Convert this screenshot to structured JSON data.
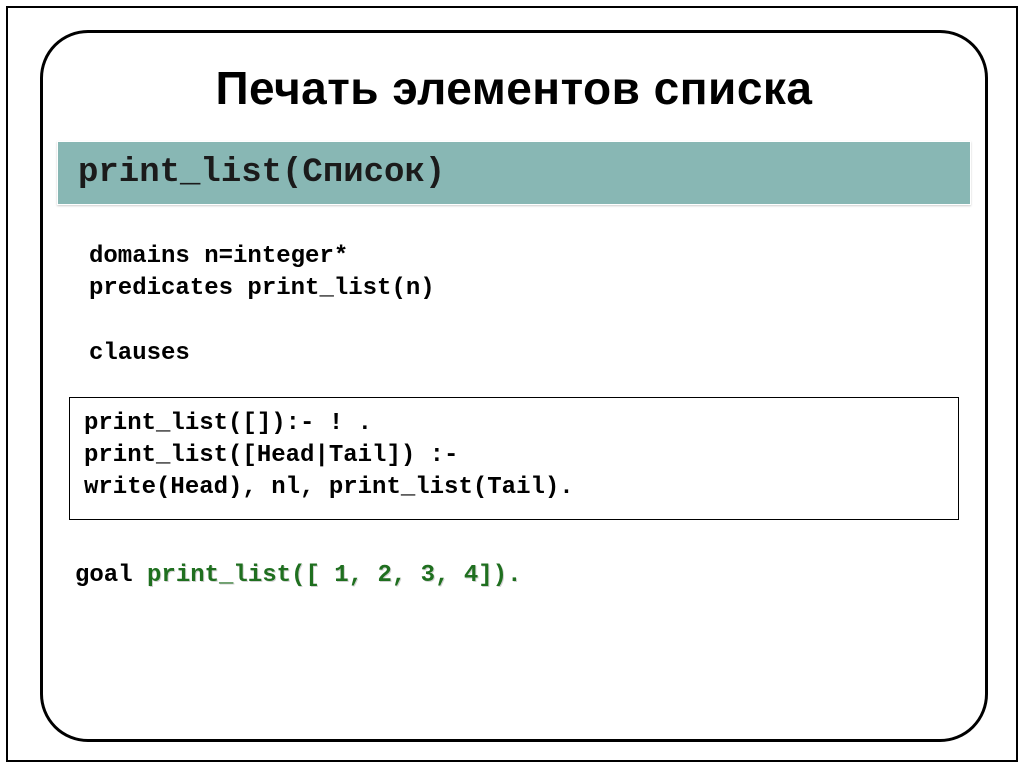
{
  "slide": {
    "title": "Печать элементов списка",
    "banner": "print_list(Список)",
    "decl_block": "domains n=integer*\npredicates print_list(n)\n\nclauses",
    "box_block": "print_list([]):- ! .\nprint_list([Head|Tail]) :-\nwrite(Head), nl, print_list(Tail).",
    "goal_prefix": "goal ",
    "goal_call": "print_list([ 1, 2, 3, 4])."
  }
}
